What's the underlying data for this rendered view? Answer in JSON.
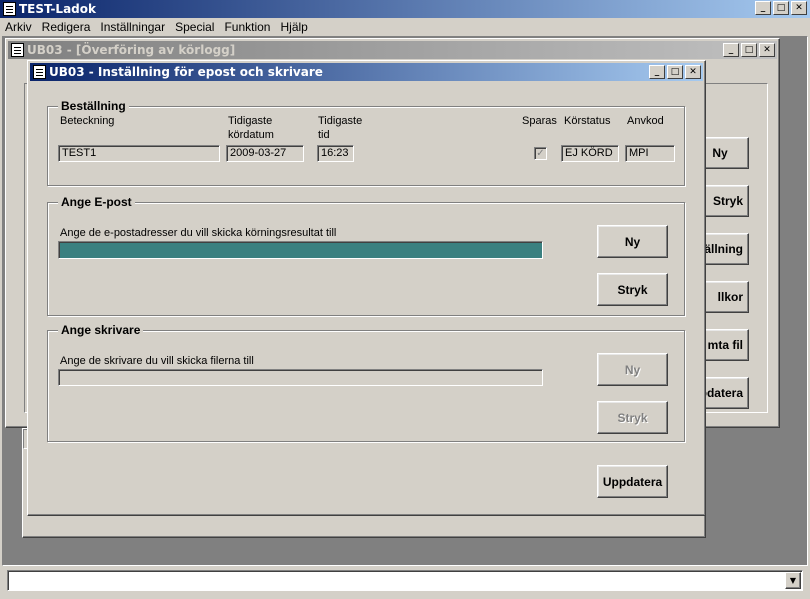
{
  "app": {
    "title": "TEST-Ladok"
  },
  "menu": [
    "Arkiv",
    "Redigera",
    "Inställningar",
    "Special",
    "Funktion",
    "Hjälp"
  ],
  "window_back": {
    "title": "UB03 - [Överföring av körlogg]",
    "side_buttons": [
      "Ny",
      "Stryk",
      "ällning",
      "llkor",
      "mta fil",
      "pdatera"
    ]
  },
  "dialog": {
    "title": "UB03 - Inställning för epost och skrivare",
    "bestallning": {
      "label": "Beställning",
      "col_beteckning": "Beteckning",
      "col_kordatum_1": "Tidigaste",
      "col_kordatum_2": "kördatum",
      "col_tid_1": "Tidigaste",
      "col_tid_2": "tid",
      "col_sparas": "Sparas",
      "col_korstatus": "Körstatus",
      "col_anvkod": "Anvkod",
      "beteckning": "TEST1",
      "kordatum": "2009-03-27",
      "tid": "16:23",
      "sparas_checked": true,
      "korstatus": "EJ KÖRD",
      "anvkod": "MPI"
    },
    "epost": {
      "label": "Ange E-post",
      "instruction": "Ange de e-postadresser du vill skicka körningsresultat till",
      "value": "",
      "new_label": "Ny",
      "delete_label": "Stryk"
    },
    "skrivare": {
      "label": "Ange skrivare",
      "instruction": "Ange de skrivare du vill skicka filerna till",
      "value": "",
      "new_label": "Ny",
      "delete_label": "Stryk"
    },
    "update_label": "Uppdatera"
  },
  "statusbar": {
    "value": ""
  },
  "colors": {
    "active_title": "#0a246a",
    "selection": "#3a8080"
  }
}
